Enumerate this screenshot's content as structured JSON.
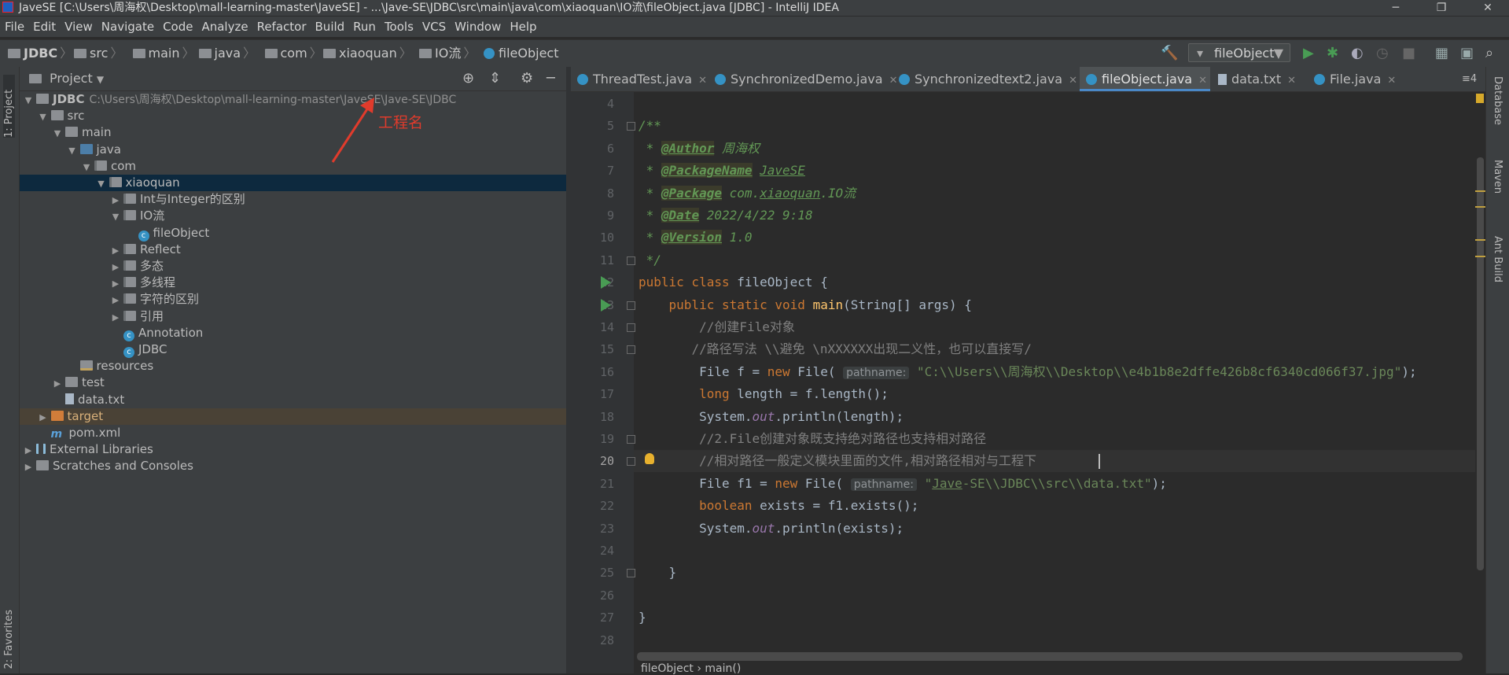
{
  "window": {
    "title": "JaveSE [C:\\Users\\周海权\\Desktop\\mall-learning-master\\JaveSE] - ...\\Jave-SE\\JDBC\\src\\main\\java\\com\\xiaoquan\\IO流\\fileObject.java [JDBC] - IntelliJ IDEA",
    "minimize": "─",
    "restore": "❐",
    "close": "✕"
  },
  "menu": [
    "File",
    "Edit",
    "View",
    "Navigate",
    "Code",
    "Analyze",
    "Refactor",
    "Build",
    "Run",
    "Tools",
    "VCS",
    "Window",
    "Help"
  ],
  "breadcrumb": [
    "JDBC",
    "src",
    "main",
    "java",
    "com",
    "xiaoquan",
    "IO流",
    "fileObject"
  ],
  "run_config": "fileObject",
  "toolbar_icons": [
    "hammer-icon",
    "run-icon",
    "debug-icon",
    "coverage-icon",
    "profile-icon",
    "stop-icon",
    "project-structure-icon",
    "layout-icon",
    "search-everywhere-icon"
  ],
  "left_stripe": {
    "project": "1: Project",
    "favorites": "2: Favorites"
  },
  "project_panel": {
    "title": "Project",
    "tree": [
      {
        "label": "JDBC",
        "path": "C:\\Users\\周海权\\Desktop\\mall-learning-master\\JaveSE\\Jave-SE\\JDBC",
        "depth": 0,
        "expanded": true,
        "icon": "module"
      },
      {
        "label": "src",
        "depth": 1,
        "expanded": true,
        "icon": "folder"
      },
      {
        "label": "main",
        "depth": 2,
        "expanded": true,
        "icon": "folder"
      },
      {
        "label": "java",
        "depth": 3,
        "expanded": true,
        "icon": "src"
      },
      {
        "label": "com",
        "depth": 4,
        "expanded": true,
        "icon": "pkg"
      },
      {
        "label": "xiaoquan",
        "depth": 5,
        "expanded": true,
        "icon": "pkg",
        "selected": true
      },
      {
        "label": "Int与Integer的区别",
        "depth": 6,
        "expanded": false,
        "icon": "pkg"
      },
      {
        "label": "IO流",
        "depth": 6,
        "expanded": true,
        "icon": "pkg"
      },
      {
        "label": "fileObject",
        "depth": 7,
        "icon": "cls"
      },
      {
        "label": "Reflect",
        "depth": 6,
        "expanded": false,
        "icon": "pkg"
      },
      {
        "label": "多态",
        "depth": 6,
        "expanded": false,
        "icon": "pkg"
      },
      {
        "label": "多线程",
        "depth": 6,
        "expanded": false,
        "icon": "pkg"
      },
      {
        "label": "字符的区别",
        "depth": 6,
        "expanded": false,
        "icon": "pkg"
      },
      {
        "label": "引用",
        "depth": 6,
        "expanded": false,
        "icon": "pkg"
      },
      {
        "label": "Annotation",
        "depth": 6,
        "icon": "cls"
      },
      {
        "label": "JDBC",
        "depth": 6,
        "icon": "cls"
      },
      {
        "label": "resources",
        "depth": 3,
        "icon": "res"
      },
      {
        "label": "test",
        "depth": 2,
        "expanded": false,
        "icon": "folder"
      },
      {
        "label": "data.txt",
        "depth": 2,
        "icon": "file"
      },
      {
        "label": "target",
        "depth": 1,
        "expanded": false,
        "icon": "orange",
        "excluded": true
      },
      {
        "label": "pom.xml",
        "depth": 1,
        "icon": "m"
      },
      {
        "label": "External Libraries",
        "depth": 0,
        "expanded": false,
        "icon": "lib"
      },
      {
        "label": "Scratches and Consoles",
        "depth": 0,
        "expanded": false,
        "icon": "scratch"
      }
    ],
    "annotation": "工程名"
  },
  "tabs": [
    {
      "label": "ThreadTest.java",
      "icon": "class"
    },
    {
      "label": "SynchronizedDemo.java",
      "icon": "class"
    },
    {
      "label": "Synchronizedtext2.java",
      "icon": "class"
    },
    {
      "label": "fileObject.java",
      "icon": "class",
      "active": true
    },
    {
      "label": "data.txt",
      "icon": "text"
    },
    {
      "label": "File.java",
      "icon": "class"
    }
  ],
  "tabs_overflow": "≡4",
  "editor": {
    "current_line": 20,
    "lines": [
      {
        "n": "4",
        "html": ""
      },
      {
        "n": "5",
        "html": "<span class='doc'>/**</span>"
      },
      {
        "n": "6",
        "html": "<span class='doc'> * </span><span class='tag'>@Author</span><span class='doc'> 周海权</span>"
      },
      {
        "n": "7",
        "html": "<span class='doc'> * </span><span class='tag'>@PackageName</span><span class='doc'> <u>JaveSE</u></span>"
      },
      {
        "n": "8",
        "html": "<span class='doc'> * </span><span class='tag'>@Package</span><span class='doc'> com.<u>xiaoquan</u>.IO流</span>"
      },
      {
        "n": "9",
        "html": "<span class='doc'> * </span><span class='tag'>@Date</span><span class='doc'> 2022/4/22 9:18</span>"
      },
      {
        "n": "10",
        "html": "<span class='doc'> * </span><span class='tag'>@Version</span><span class='doc'> 1.0</span>"
      },
      {
        "n": "11",
        "html": "<span class='doc'> */</span>"
      },
      {
        "n": "12",
        "html": "<span class='kw'>public class </span>fileObject {"
      },
      {
        "n": "13",
        "html": "    <span class='kw'>public static void </span><span class='fn'>main</span>(String[] args) {"
      },
      {
        "n": "14",
        "html": "        <span class='cm'>//创建File对象</span>"
      },
      {
        "n": "15",
        "html": "       <span class='cm'>//路径写法 \\\\避免 \\nXXXXXX出现二义性，也可以直接写/</span>"
      },
      {
        "n": "16",
        "html": "        File f = <span class='kw'>new </span>File( <span class='hint'>pathname:</span> <span class='str'>\"C:\\\\Users\\\\周海权\\\\Desktop\\\\e4b1b8e2dffe426b8cf6340cd066f37.jpg\"</span>);"
      },
      {
        "n": "17",
        "html": "        <span class='kw'>long </span>length = f.length();"
      },
      {
        "n": "18",
        "html": "        System.<span class='fld'>out</span>.println(length);"
      },
      {
        "n": "19",
        "html": "        <span class='cm'>//2.File创建对象既支持绝对路径也支持相对路径</span>"
      },
      {
        "n": "20",
        "html": "        <span class='cm'>//相对路径一般定义模块里面的文件,相对路径相对与工程下</span>"
      },
      {
        "n": "21",
        "html": "        File f1 = <span class='kw'>new </span>File( <span class='hint'>pathname:</span> <span class='str'>\"<u>Jave</u>-SE\\\\JDBC\\\\src\\\\data.txt\"</span>);"
      },
      {
        "n": "22",
        "html": "        <span class='kw'>boolean </span>exists = f1.exists();"
      },
      {
        "n": "23",
        "html": "        System.<span class='fld'>out</span>.println(exists);"
      },
      {
        "n": "24",
        "html": ""
      },
      {
        "n": "25",
        "html": "    }"
      },
      {
        "n": "26",
        "html": ""
      },
      {
        "n": "27",
        "html": "}"
      },
      {
        "n": "28",
        "html": ""
      }
    ],
    "bottom_breadcrumb": "fileObject  ›  main()"
  },
  "right_stripe": [
    "Database",
    "Maven",
    "Ant Build"
  ]
}
